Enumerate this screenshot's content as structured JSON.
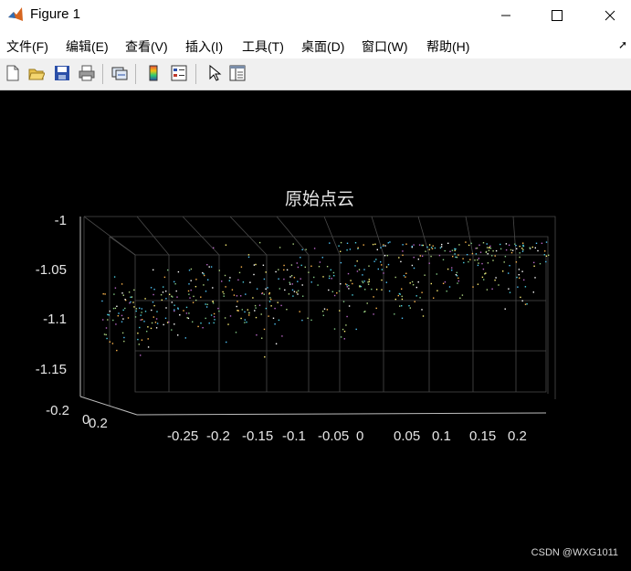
{
  "window": {
    "title": "Figure 1"
  },
  "menu": {
    "items": [
      "文件(F)",
      "编辑(E)",
      "查看(V)",
      "插入(I)",
      "工具(T)",
      "桌面(D)",
      "窗口(W)",
      "帮助(H)"
    ]
  },
  "toolbar": {
    "icons": [
      "new-figure-icon",
      "open-file-icon",
      "save-icon",
      "print-icon",
      "link-plot-icon",
      "colorbar-icon",
      "legend-icon",
      "pointer-icon",
      "property-inspector-icon"
    ]
  },
  "chart_data": {
    "type": "scatter",
    "title": "原始点云",
    "xlabel": "",
    "ylabel": "",
    "zlabel": "",
    "x_ticks": [
      "-0.25",
      "-0.2",
      "-0.15",
      "-0.1",
      "-0.05",
      "0",
      "0.05",
      "0.1",
      "0.15",
      "0.2"
    ],
    "y_ticks": [
      "-0.2",
      "0",
      "0.2"
    ],
    "z_ticks": [
      "-1",
      "-1.05",
      "-1.1",
      "-1.15"
    ],
    "xlim": [
      -0.3,
      0.25
    ],
    "ylim": [
      -0.2,
      0.2
    ],
    "zlim": [
      -1.18,
      -1.0
    ],
    "grid": true,
    "background": "#000000",
    "point_count": 600
  },
  "watermark": "CSDN @WXG1011"
}
